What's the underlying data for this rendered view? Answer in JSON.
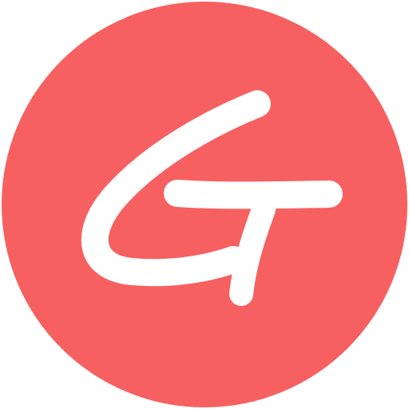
{
  "logo": {
    "letter": "G",
    "badge_color": "#F76060",
    "glyph_color": "#FFFFFF"
  }
}
